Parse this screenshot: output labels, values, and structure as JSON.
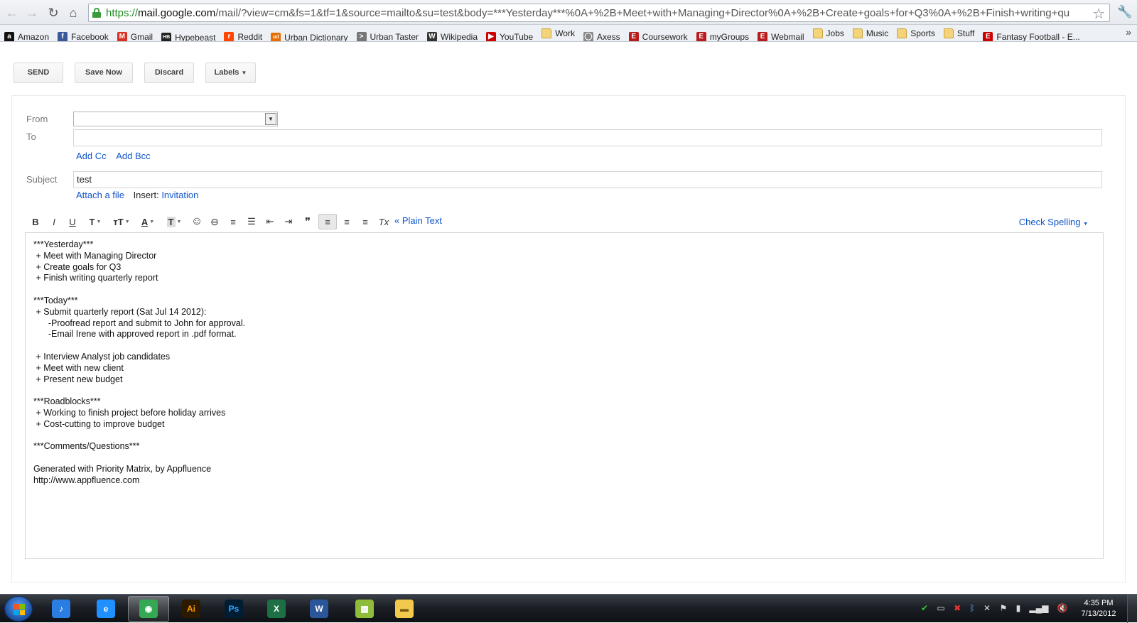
{
  "browser": {
    "url_scheme": "https://",
    "url_host": "mail.google.com",
    "url_rest": "/mail/?view=cm&fs=1&tf=1&source=mailto&su=test&body=***Yesterday***%0A+%2B+Meet+with+Managing+Director%0A+%2B+Create+goals+for+Q3%0A+%2B+Finish+writing+qu"
  },
  "bookmarks": [
    {
      "label": "Amazon",
      "icon": "amazon-icon",
      "glyph": "a",
      "color": "#111111"
    },
    {
      "label": "Facebook",
      "icon": "facebook-icon",
      "glyph": "f",
      "color": "#3b5998"
    },
    {
      "label": "Gmail",
      "icon": "gmail-icon",
      "glyph": "M",
      "color": "#d93025"
    },
    {
      "label": "Hypebeast",
      "icon": "hypebeast-icon",
      "glyph": "HB",
      "color": "#222222"
    },
    {
      "label": "Reddit",
      "icon": "reddit-icon",
      "glyph": "r",
      "color": "#ff4500"
    },
    {
      "label": "Urban Dictionary",
      "icon": "urban-dictionary-icon",
      "glyph": "ud",
      "color": "#e86c00"
    },
    {
      "label": "Urban Taster",
      "icon": "urban-taster-icon",
      "glyph": ">",
      "color": "#777777"
    },
    {
      "label": "Wikipedia",
      "icon": "wikipedia-icon",
      "glyph": "W",
      "color": "#333333"
    },
    {
      "label": "YouTube",
      "icon": "youtube-icon",
      "glyph": "▶",
      "color": "#cc0000"
    },
    {
      "label": "Work",
      "icon": "folder-icon",
      "glyph": "",
      "color": "folder"
    },
    {
      "label": "Axess",
      "icon": "axess-icon",
      "glyph": "◯",
      "color": "#888888"
    },
    {
      "label": "Coursework",
      "icon": "coursework-icon",
      "glyph": "E",
      "color": "#b91c1c"
    },
    {
      "label": "myGroups",
      "icon": "mygroups-icon",
      "glyph": "E",
      "color": "#b91c1c"
    },
    {
      "label": "Webmail",
      "icon": "webmail-icon",
      "glyph": "E",
      "color": "#b91c1c"
    },
    {
      "label": "Jobs",
      "icon": "folder-icon",
      "glyph": "",
      "color": "folder"
    },
    {
      "label": "Music",
      "icon": "folder-icon",
      "glyph": "",
      "color": "folder"
    },
    {
      "label": "Sports",
      "icon": "folder-icon",
      "glyph": "",
      "color": "folder"
    },
    {
      "label": "Stuff",
      "icon": "folder-icon",
      "glyph": "",
      "color": "folder"
    },
    {
      "label": "Fantasy Football - E...",
      "icon": "espn-icon",
      "glyph": "E",
      "color": "#cc0000"
    }
  ],
  "toolbar": {
    "send": "SEND",
    "save_now": "Save Now",
    "discard": "Discard",
    "labels": "Labels"
  },
  "compose": {
    "from_label": "From",
    "to_label": "To",
    "add_cc": "Add Cc",
    "add_bcc": "Add Bcc",
    "subject_label": "Subject",
    "subject_value": "test",
    "attach_file": "Attach a file",
    "insert_label": "Insert:",
    "invitation": "Invitation",
    "plain_text": "« Plain Text",
    "check_spelling": "Check Spelling",
    "body": "***Yesterday***\n + Meet with Managing Director\n + Create goals for Q3\n + Finish writing quarterly report\n\n***Today***\n + Submit quarterly report (Sat Jul 14 2012):\n      -Proofread report and submit to John for approval.\n      -Email Irene with approved report in .pdf format.\n\n + Interview Analyst job candidates\n + Meet with new client\n + Present new budget\n\n***Roadblocks***\n + Working to finish project before holiday arrives\n + Cost-cutting to improve budget\n\n***Comments/Questions***\n\nGenerated with Priority Matrix, by Appfluence\nhttp://www.appfluence.com"
  },
  "format_toolbar": {
    "bold": "B",
    "italic": "I",
    "underline": "U",
    "font": "T",
    "size": "тT",
    "text_color": "A",
    "highlight": "T",
    "emoji": "☺",
    "link": "⊖",
    "numbered_list": "≡",
    "bulleted_list": "☰",
    "indent_less": "⇤",
    "indent_more": "⇥",
    "quote": "❞",
    "align_left": "≡",
    "align_center": "≡",
    "align_right": "≡",
    "remove_format": "Tx"
  },
  "taskbar": {
    "apps": [
      {
        "name": "itunes-icon",
        "glyph": "♪",
        "bg": "#2a7de1",
        "fg": "#ffffff"
      },
      {
        "name": "internet-explorer-icon",
        "glyph": "e",
        "bg": "#1e90ff",
        "fg": "#ffffff"
      },
      {
        "name": "chrome-icon",
        "glyph": "◉",
        "bg": "#34a853",
        "fg": "#ffffff"
      },
      {
        "name": "illustrator-icon",
        "glyph": "Ai",
        "bg": "#2b1a00",
        "fg": "#ff9a00"
      },
      {
        "name": "photoshop-icon",
        "glyph": "Ps",
        "bg": "#001d34",
        "fg": "#31a8ff"
      },
      {
        "name": "excel-icon",
        "glyph": "X",
        "bg": "#1d7044",
        "fg": "#ffffff"
      },
      {
        "name": "word-icon",
        "glyph": "W",
        "bg": "#2b579a",
        "fg": "#ffffff"
      },
      {
        "name": "picasa-icon",
        "glyph": "▦",
        "bg": "#8fbc3a",
        "fg": "#ffffff"
      },
      {
        "name": "explorer-icon",
        "glyph": "▬",
        "bg": "#f2c94c",
        "fg": "#7a5b12"
      }
    ],
    "time": "4:35 PM",
    "date": "7/13/2012"
  }
}
